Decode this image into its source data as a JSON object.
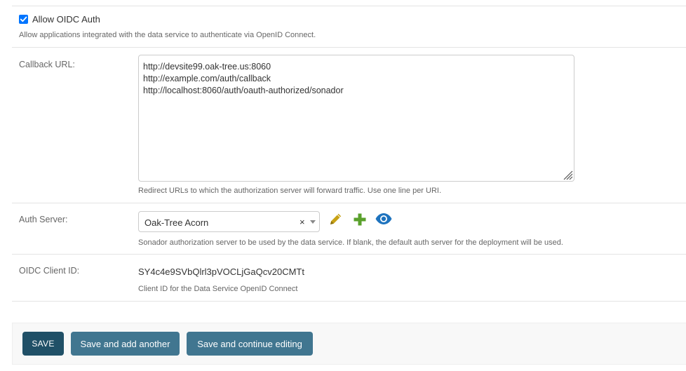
{
  "oidc": {
    "checkbox_label": "Allow OIDC Auth",
    "checked": true,
    "help": "Allow applications integrated with the data service to authenticate via OpenID Connect."
  },
  "callback": {
    "label": "Callback URL:",
    "lines": [
      "http://devsite99.oak-tree.us:8060",
      "http://example.com/auth/callback",
      "http://localhost:8060/auth/oauth-authorized/sonador"
    ],
    "help": "Redirect URLs to which the authorization server will forward traffic. Use one line per URI."
  },
  "auth_server": {
    "label": "Auth Server:",
    "selected": "Oak-Tree Acorn",
    "clear_symbol": "×",
    "help": "Sonador authorization server to be used by the data service. If blank, the default auth server for the deployment will be used.",
    "icons": [
      "pencil-icon",
      "plus-icon",
      "eye-icon"
    ]
  },
  "client_id": {
    "label": "OIDC Client ID:",
    "value": "SY4c4e9SVbQlrl3pVOCLjGaQcv20CMTt",
    "help": "Client ID for the Data Service OpenID Connect"
  },
  "buttons": {
    "save": "SAVE",
    "save_add": "Save and add another",
    "save_continue": "Save and continue editing"
  },
  "colors": {
    "primary_dark": "#205067",
    "primary": "#417690",
    "checkbox": "#0075ff",
    "pencil": "#c8a215",
    "plus": "#5aa02c",
    "eye": "#1e73be"
  }
}
